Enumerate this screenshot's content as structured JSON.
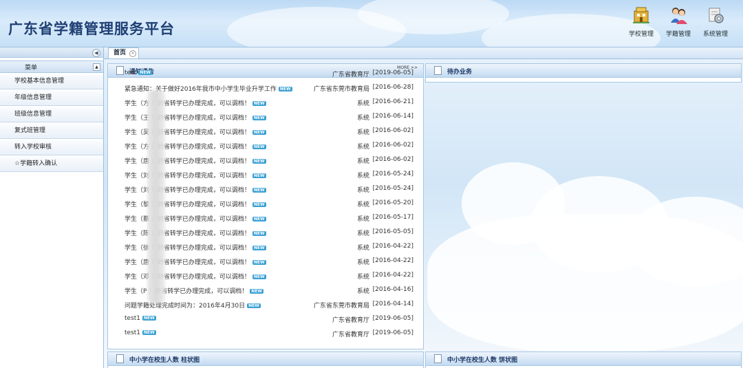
{
  "header": {
    "title": "广东省学籍管理服务平台",
    "tools": [
      {
        "label": "学校管理",
        "icon": "school-building-icon"
      },
      {
        "label": "学籍管理",
        "icon": "students-icon"
      },
      {
        "label": "系统管理",
        "icon": "system-gear-icon"
      }
    ]
  },
  "sidebar": {
    "menu_label": "菜单",
    "items": [
      {
        "label": "学校基本信息管理"
      },
      {
        "label": "年级信息管理"
      },
      {
        "label": "班级信息管理"
      },
      {
        "label": "复式班管理"
      },
      {
        "label": "转入学校审核"
      },
      {
        "label": "☆学籍转入确认"
      }
    ]
  },
  "tabs": [
    {
      "label": "首页"
    }
  ],
  "notice_panel": {
    "title": "通知通告",
    "more": "MORE >>",
    "new_badge": "NEW",
    "rows": [
      {
        "text": "test",
        "new": true,
        "source": "广东省教育厅",
        "date": "[2019-06-05]"
      },
      {
        "text": "紧急通知：关于做好2016年我市中小学生毕业升学工作",
        "new": true,
        "source": "广东省东莞市教育局",
        "date": "[2016-06-28]"
      },
      {
        "text": "学生（方 ）跨省转学已办理完成，可以调档！",
        "new": true,
        "source": "系统",
        "date": "[2016-06-21]"
      },
      {
        "text": "学生（王 ）跨省转学已办理完成，可以调档！",
        "new": true,
        "source": "系统",
        "date": "[2016-06-14]"
      },
      {
        "text": "学生（吴 ）跨省转学已办理完成，可以调档！",
        "new": true,
        "source": "系统",
        "date": "[2016-06-02]"
      },
      {
        "text": "学生（方 ）跨省转学已办理完成，可以调档！",
        "new": true,
        "source": "系统",
        "date": "[2016-06-02]"
      },
      {
        "text": "学生（唐 ）跨省转学已办理完成，可以调档！",
        "new": true,
        "source": "系统",
        "date": "[2016-06-02]"
      },
      {
        "text": "学生（刘 ）跨省转学已办理完成，可以调档！",
        "new": true,
        "source": "系统",
        "date": "[2016-05-24]"
      },
      {
        "text": "学生（刘 ）跨省转学已办理完成，可以调档！",
        "new": true,
        "source": "系统",
        "date": "[2016-05-24]"
      },
      {
        "text": "学生（黎 ）跨省转学已办理完成，可以调档！",
        "new": true,
        "source": "系统",
        "date": "[2016-05-20]"
      },
      {
        "text": "学生（蔡 ）跨省转学已办理完成，可以调档！",
        "new": true,
        "source": "系统",
        "date": "[2016-05-17]"
      },
      {
        "text": "学生（陈 ）跨省转学已办理完成，可以调档！",
        "new": true,
        "source": "系统",
        "date": "[2016-05-05]"
      },
      {
        "text": "学生（徐 ）跨省转学已办理完成，可以调档！",
        "new": true,
        "source": "系统",
        "date": "[2016-04-22]"
      },
      {
        "text": "学生（唐 ）跨省转学已办理完成，可以调档！",
        "new": true,
        "source": "系统",
        "date": "[2016-04-22]"
      },
      {
        "text": "学生（邓 ）跨省转学已办理完成，可以调档！",
        "new": true,
        "source": "系统",
        "date": "[2016-04-22]"
      },
      {
        "text": "学生（P ）跨省转学已办理完成，可以调档！",
        "new": true,
        "source": "系统",
        "date": "[2016-04-16]"
      },
      {
        "text": "问题学籍处理完成时间为：2016年4月30日",
        "new": true,
        "source": "广东省东莞市教育局",
        "date": "[2016-04-14]"
      },
      {
        "text": "test1",
        "new": true,
        "source": "广东省教育厅",
        "date": "[2019-06-05]"
      },
      {
        "text": "test1",
        "new": true,
        "source": "广东省教育厅",
        "date": "[2019-06-05]"
      }
    ]
  },
  "todo_panel": {
    "title": "待办业务"
  },
  "bar_panel": {
    "title": "中小学在校生人数 柱状图"
  },
  "pie_panel": {
    "title": "中小学在校生人数 饼状图"
  }
}
